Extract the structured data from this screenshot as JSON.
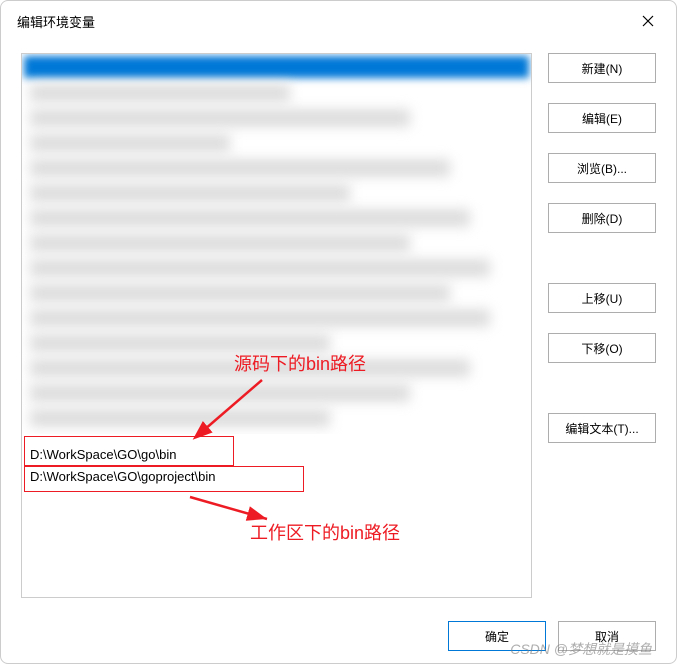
{
  "dialog": {
    "title": "编辑环境变量"
  },
  "paths": {
    "row1": "D:\\WorkSpace\\GO\\go\\bin",
    "row2": "D:\\WorkSpace\\GO\\goproject\\bin"
  },
  "annotations": {
    "source_bin": "源码下的bin路径",
    "workspace_bin": "工作区下的bin路径"
  },
  "buttons": {
    "new": "新建(N)",
    "edit": "编辑(E)",
    "browse": "浏览(B)...",
    "delete": "删除(D)",
    "move_up": "上移(U)",
    "move_down": "下移(O)",
    "edit_text": "编辑文本(T)...",
    "ok": "确定",
    "cancel": "取消"
  },
  "watermark": "CSDN @梦想就是摸鱼"
}
